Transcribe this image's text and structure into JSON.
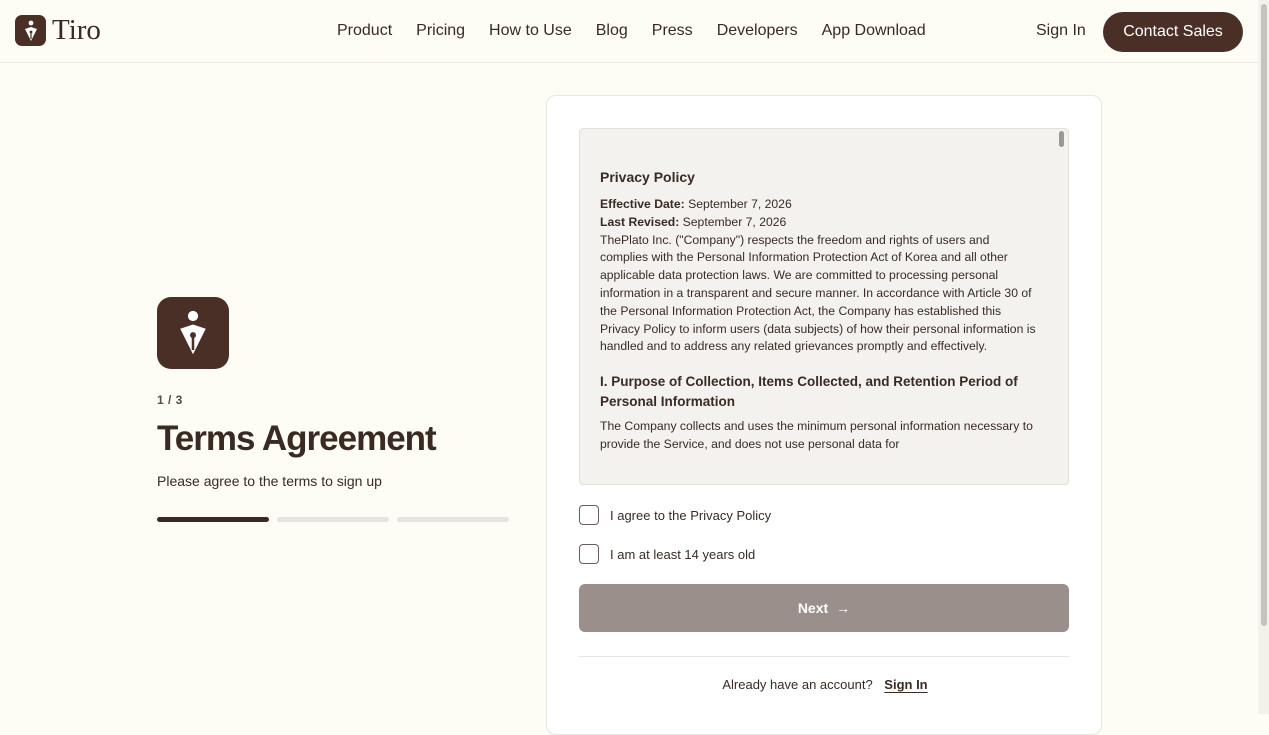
{
  "brand": {
    "name": "Tiro"
  },
  "nav": {
    "items": [
      "Product",
      "Pricing",
      "How to Use",
      "Blog",
      "Press",
      "Developers",
      "App Download"
    ],
    "sign_in": "Sign In",
    "contact": "Contact Sales"
  },
  "signup": {
    "step": "1 / 3",
    "title": "Terms Agreement",
    "subtitle": "Please agree to the terms to sign up",
    "progress": {
      "current": 1,
      "total": 3
    }
  },
  "terms": {
    "heading": "Privacy Policy",
    "effective_label": "Effective Date:",
    "effective_value": "September 7, 2026",
    "revised_label": "Last Revised:",
    "revised_value": "September 7, 2026",
    "intro": "ThePlato Inc. (\"Company\") respects the freedom and rights of users and complies with the Personal Information Protection Act of Korea and all other applicable data protection laws. We are committed to processing personal information in a transparent and secure manner. In accordance with Article 30 of the Personal Information Protection Act, the Company has established this Privacy Policy to inform users (data subjects) of how their personal information is handled and to address any related grievances promptly and effectively.",
    "section1_title": "I. Purpose of Collection, Items Collected, and Retention Period of Personal Information",
    "section1_body": "The Company collects and uses the minimum personal information necessary to provide the Service, and does not use personal data for"
  },
  "checks": {
    "privacy": "I agree to the Privacy Policy",
    "age": "I am at least 14 years old"
  },
  "actions": {
    "next": "Next",
    "already": "Already have an account?",
    "sign_in": "Sign In"
  },
  "colors": {
    "brand_dark": "#4a2f26",
    "background": "#fdfcf5",
    "button_disabled": "#9a8f8b"
  }
}
